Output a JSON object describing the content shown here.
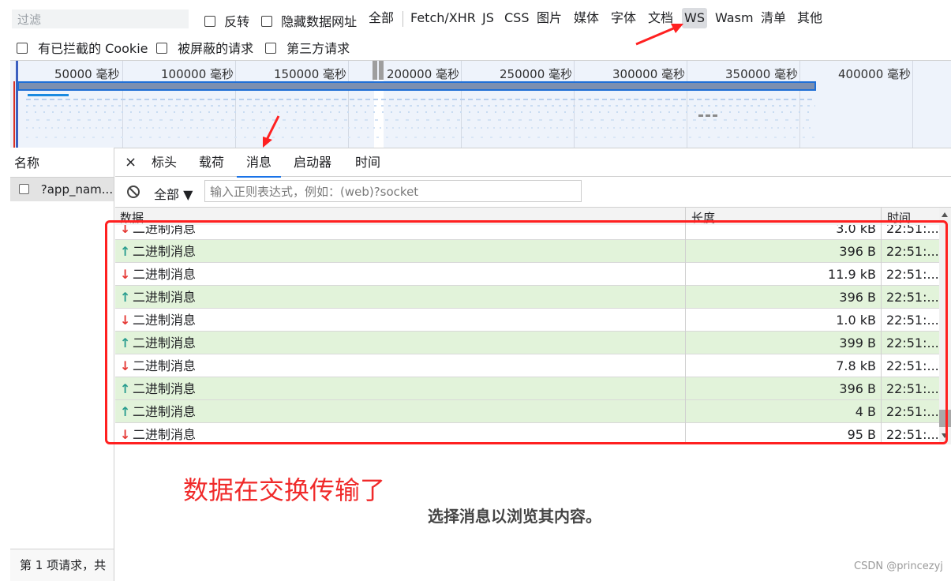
{
  "filter_bar": {
    "filter_placeholder": "过滤",
    "invert_label": "反转",
    "hide_data_urls_label": "隐藏数据网址",
    "types": [
      "全部",
      "Fetch/XHR",
      "JS",
      "CSS",
      "图片",
      "媒体",
      "字体",
      "文档",
      "WS",
      "Wasm",
      "清单",
      "其他"
    ],
    "active_type": "WS",
    "blocked_cookies_label": "有已拦截的 Cookie",
    "blocked_requests_label": "被屏蔽的请求",
    "third_party_label": "第三方请求"
  },
  "overview": {
    "ticks": [
      "50000 毫秒",
      "100000 毫秒",
      "150000 毫秒",
      "200000 毫秒",
      "250000 毫秒",
      "300000 毫秒",
      "350000 毫秒",
      "400000 毫秒"
    ]
  },
  "request_list": {
    "header": "名称",
    "request_name": "?app_name=...",
    "request_name_display": "?app_nam...",
    "footer": "第 1 项请求，共"
  },
  "detail": {
    "close_symbol": "×",
    "tabs": [
      "标头",
      "载荷",
      "消息",
      "启动器",
      "时间"
    ],
    "active_tab": "消息",
    "message_filter": {
      "dropdown_label": "全部 ▼",
      "placeholder": "输入正则表达式，例如：(web)?socket"
    },
    "table": {
      "columns": [
        "数据",
        "长度",
        "时间"
      ],
      "rows": [
        {
          "direction": "down",
          "data": "二进制消息",
          "length": "3.0 kB",
          "time": "22:51:..."
        },
        {
          "direction": "up",
          "data": "二进制消息",
          "length": "396 B",
          "time": "22:51:..."
        },
        {
          "direction": "down",
          "data": "二进制消息",
          "length": "11.9 kB",
          "time": "22:51:..."
        },
        {
          "direction": "up",
          "data": "二进制消息",
          "length": "396 B",
          "time": "22:51:..."
        },
        {
          "direction": "down",
          "data": "二进制消息",
          "length": "1.0 kB",
          "time": "22:51:..."
        },
        {
          "direction": "up",
          "data": "二进制消息",
          "length": "399 B",
          "time": "22:51:..."
        },
        {
          "direction": "down",
          "data": "二进制消息",
          "length": "7.8 kB",
          "time": "22:51:..."
        },
        {
          "direction": "up",
          "data": "二进制消息",
          "length": "396 B",
          "time": "22:51:..."
        },
        {
          "direction": "up",
          "data": "二进制消息",
          "length": "4 B",
          "time": "22:51:..."
        },
        {
          "direction": "down",
          "data": "二进制消息",
          "length": "95 B",
          "time": "22:51:..."
        }
      ]
    },
    "empty_message": "选择消息以浏览其内容。"
  },
  "annotation": {
    "text": "数据在交换传输了",
    "color": "#f02a2a"
  },
  "watermark": "CSDN @princezyj",
  "colors": {
    "up_row_bg": "#e2f3da",
    "up_arrow": "#2a9d8f",
    "down_arrow": "#e53935",
    "active_tab_underline": "#1a73e8",
    "annotation_red": "#ff2020"
  }
}
